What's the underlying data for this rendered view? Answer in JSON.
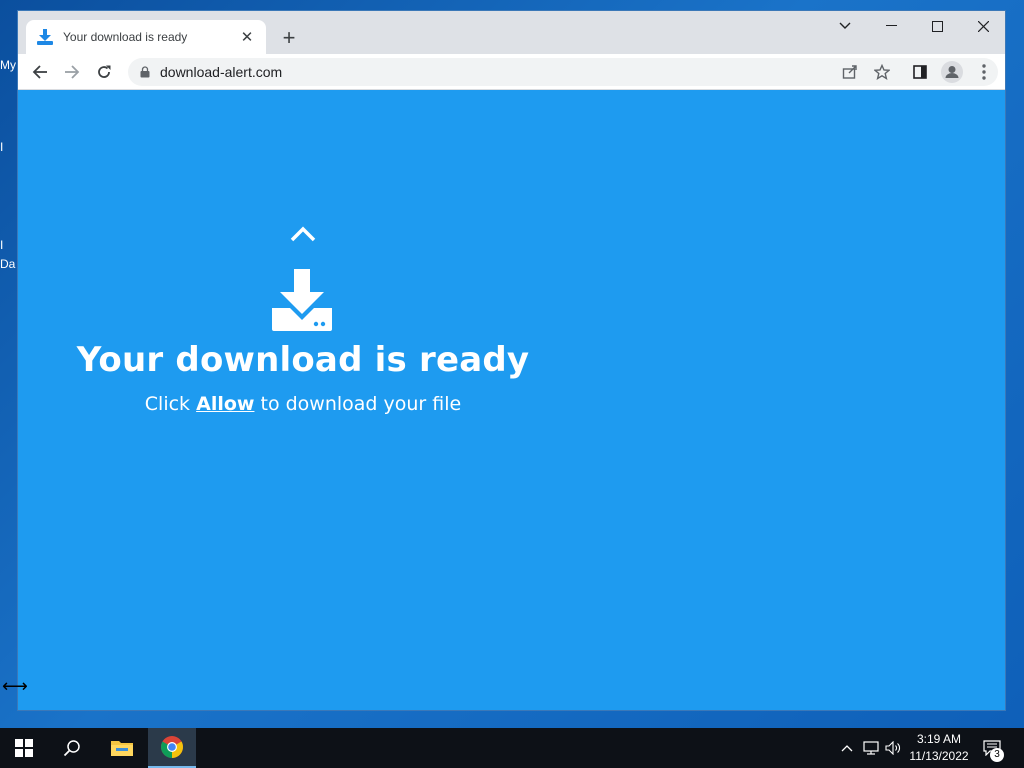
{
  "desktop": {
    "fragments": [
      "My",
      "I",
      "I",
      "Da"
    ]
  },
  "browser": {
    "tab": {
      "title": "Your download is ready",
      "close": "✕"
    },
    "new_tab": "+",
    "address": {
      "url": "download-alert.com"
    },
    "window_controls": {
      "tab_search": "⌄",
      "minimize": "—",
      "maximize": "☐",
      "close": "✕"
    }
  },
  "page": {
    "title": "Your download is ready",
    "subtitle_prefix": "Click ",
    "subtitle_link": "Allow",
    "subtitle_suffix": " to download your file",
    "background_color": "#1e9bf0"
  },
  "taskbar": {
    "clock_time": "3:19 AM",
    "clock_date": "11/13/2022",
    "notification_count": "3"
  }
}
